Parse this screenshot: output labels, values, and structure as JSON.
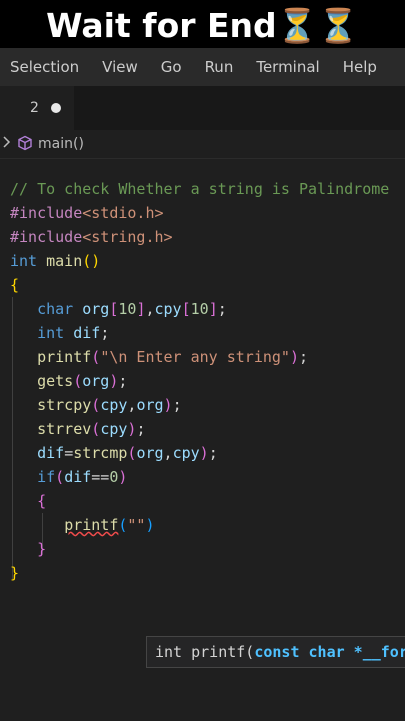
{
  "banner": {
    "title": "Wait for End⏳⏳"
  },
  "menu": [
    "Selection",
    "View",
    "Go",
    "Run",
    "Terminal",
    "Help"
  ],
  "tab": {
    "label": "2"
  },
  "breadcrumb": {
    "symbol": "main()"
  },
  "code": [
    "// To check Whether a string is Palindrome",
    "#include<stdio.h>",
    "#include<string.h>",
    "int main()",
    "{",
    "char org[10],cpy[10];",
    "int dif;",
    "printf(\"\\n Enter any string\");",
    "gets(org);",
    "strcpy(cpy,org);",
    "strrev(cpy);",
    "dif=strcmp(org,cpy);",
    "if(dif==0)",
    "{",
    "printf(\"\")",
    "}",
    "}"
  ],
  "hint": {
    "prefix": "int printf(",
    "param": "const char *__format"
  },
  "colors": {
    "background": "#1f1f1f",
    "keyword": "#569cd6",
    "string": "#ce9178",
    "comment": "#6a9955"
  }
}
